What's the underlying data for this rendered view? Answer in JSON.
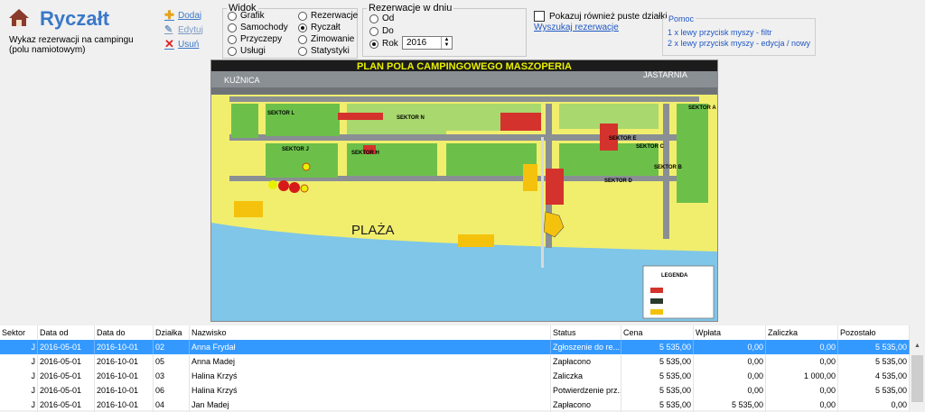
{
  "app": {
    "title": "Ryczałt",
    "subtitle": "Wykaz rezerwacji na campingu (polu namiotowym)"
  },
  "actions": {
    "add": "Dodaj",
    "edit": "Edytuj",
    "delete": "Usuń"
  },
  "view": {
    "legend": "Widok",
    "options": [
      "Grafik",
      "Samochody",
      "Przyczepy",
      "Usługi",
      "Rezerwacje",
      "Ryczałt",
      "Zimowanie",
      "Statystyki"
    ],
    "selected": "Ryczałt"
  },
  "reservation_day": {
    "legend": "Rezerwacje w dniu",
    "options": [
      "Od",
      "Do",
      "Rok"
    ],
    "selected": "Rok",
    "year": "2016"
  },
  "show_empty": "Pokazuj również puste działki",
  "search_link": "Wyszukaj rezerwacje",
  "help": {
    "title": "Pomoc",
    "line1": "1 x lewy przycisk myszy - filtr",
    "line2": "2 x lewy przycisk myszy - edycja / nowy"
  },
  "map": {
    "title": "PLAN  POLA CAMPINGOWEGO MASZOPERIA",
    "road_left": "KUŹNICA",
    "road_right": "JASTARNIA",
    "beach": "PLAŻA",
    "legend_title": "LEGENDA",
    "sectors": [
      "SEKTOR L",
      "SEKTOR N",
      "SEKTOR J",
      "SEKTOR H",
      "SEKTOR E",
      "SEKTOR C",
      "SEKTOR D",
      "SEKTOR B",
      "SEKTOR A"
    ]
  },
  "table": {
    "columns": [
      "Sektor",
      "Data od",
      "Data do",
      "Działka",
      "Nazwisko",
      "Status",
      "Cena",
      "Wpłata",
      "Zaliczka",
      "Pozostało"
    ],
    "rows": [
      {
        "sektor": "J",
        "od": "2016-05-01",
        "do": "2016-10-01",
        "dzialka": "02",
        "nazwisko": "Anna Frydał",
        "status": "Zgłoszenie do re...",
        "cena": "5 535,00",
        "wplata": "0,00",
        "zaliczka": "0,00",
        "pozostalo": "5 535,00"
      },
      {
        "sektor": "J",
        "od": "2016-05-01",
        "do": "2016-10-01",
        "dzialka": "05",
        "nazwisko": "Anna Madej",
        "status": "Zapłacono",
        "cena": "5 535,00",
        "wplata": "0,00",
        "zaliczka": "0,00",
        "pozostalo": "5 535,00"
      },
      {
        "sektor": "J",
        "od": "2016-05-01",
        "do": "2016-10-01",
        "dzialka": "03",
        "nazwisko": "Halina Krzyś",
        "status": "Zaliczka",
        "cena": "5 535,00",
        "wplata": "0,00",
        "zaliczka": "1 000,00",
        "pozostalo": "4 535,00"
      },
      {
        "sektor": "J",
        "od": "2016-05-01",
        "do": "2016-10-01",
        "dzialka": "06",
        "nazwisko": "Halina Krzyś",
        "status": "Potwierdzenie prz...",
        "cena": "5 535,00",
        "wplata": "0,00",
        "zaliczka": "0,00",
        "pozostalo": "5 535,00"
      },
      {
        "sektor": "J",
        "od": "2016-05-01",
        "do": "2016-10-01",
        "dzialka": "04",
        "nazwisko": "Jan Madej",
        "status": "Zapłacono",
        "cena": "5 535,00",
        "wplata": "5 535,00",
        "zaliczka": "0,00",
        "pozostalo": "0,00"
      }
    ]
  }
}
